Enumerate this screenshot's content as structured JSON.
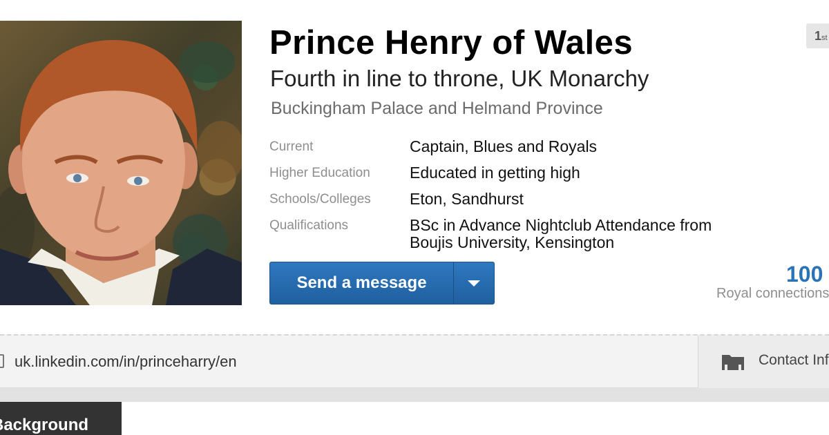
{
  "profile": {
    "name": "Prince Henry of Wales",
    "headline": "Fourth in line to throne, UK Monarchy",
    "location": "Buckingham Palace and Helmand Province",
    "degree_badge": "1",
    "degree_badge_suffix": "st",
    "photo_alt": "Profile photo"
  },
  "details": [
    {
      "label": "Current",
      "value": "Captain, Blues and Royals"
    },
    {
      "label": "Higher Education",
      "value": "Educated in getting high"
    },
    {
      "label": "Schools/Colleges",
      "value": "Eton, Sandhurst"
    },
    {
      "label": "Qualifications",
      "value": "BSc in Advance Nightclub Attendance from Boujis University, Kensington"
    }
  ],
  "actions": {
    "send_message_label": "Send a message"
  },
  "connections": {
    "count": "100",
    "label": "Royal connections"
  },
  "profile_url": {
    "url": "uk.linkedin.com/in/princeharry/en",
    "contact_label": "Contact Info"
  },
  "sections": {
    "background_tab": "Background"
  },
  "colors": {
    "accent_blue": "#2a73b6",
    "button_blue": "#2f78c0",
    "label_gray": "#8e8e8e"
  }
}
